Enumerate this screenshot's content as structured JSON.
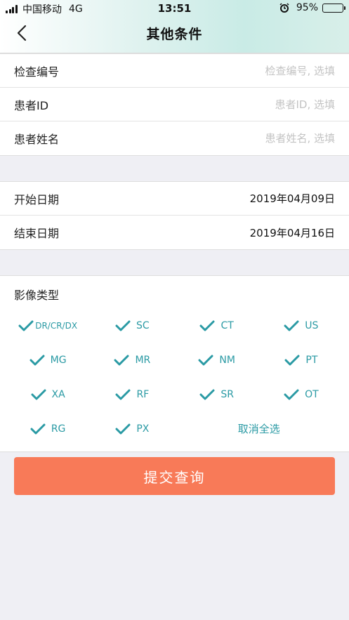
{
  "status_bar": {
    "carrier": "中国移动",
    "network": "4G",
    "time": "13:51",
    "battery": "95%",
    "battery_level": 0.95
  },
  "nav": {
    "title": "其他条件"
  },
  "query_fields": [
    {
      "label": "检查编号",
      "placeholder": "检查编号, 选填"
    },
    {
      "label": "患者ID",
      "placeholder": "患者ID, 选填"
    },
    {
      "label": "患者姓名",
      "placeholder": "患者姓名, 选填"
    }
  ],
  "dates": [
    {
      "label": "开始日期",
      "value": "2019年04月09日"
    },
    {
      "label": "结束日期",
      "value": "2019年04月16日"
    }
  ],
  "modality": {
    "title": "影像类型",
    "items": [
      "DR/CR/DX",
      "SC",
      "CT",
      "US",
      "MG",
      "MR",
      "NM",
      "PT",
      "XA",
      "RF",
      "SR",
      "OT",
      "RG",
      "PX"
    ],
    "deselect_all": "取消全选",
    "check_color": "#2a9aa4"
  },
  "submit": {
    "label": "提交查询",
    "color": "#f87a58"
  }
}
